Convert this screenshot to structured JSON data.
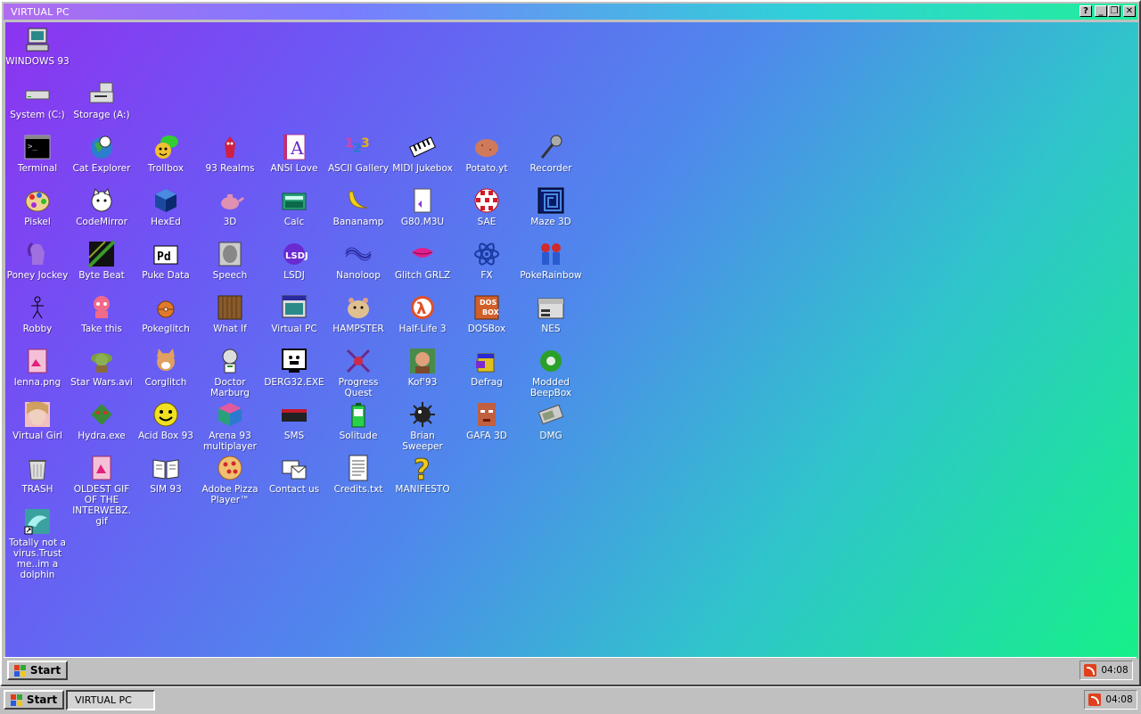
{
  "window": {
    "title": "VIRTUAL PC",
    "buttons": {
      "help": "?",
      "minimize": "_",
      "restore": "❐",
      "close": "✕"
    }
  },
  "desktop": {
    "icons": [
      {
        "label": "WINDOWS 93",
        "icon": "computer-icon"
      },
      {
        "label": "System (C:)",
        "icon": "hard-drive-icon"
      },
      {
        "label": "Storage (A:)",
        "icon": "floppy-drive-icon"
      },
      {
        "label": "Terminal",
        "icon": "terminal-icon"
      },
      {
        "label": "Cat Explorer",
        "icon": "cat-globe-icon"
      },
      {
        "label": "Trollbox",
        "icon": "chat-face-icon"
      },
      {
        "label": "93 Realms",
        "icon": "red-creature-icon"
      },
      {
        "label": "ANSI Love",
        "icon": "letter-a-book-icon"
      },
      {
        "label": "ASCII Gallery",
        "icon": "numbers-123-icon"
      },
      {
        "label": "MIDI Jukebox",
        "icon": "piano-keys-icon"
      },
      {
        "label": "Potato.yt",
        "icon": "potato-icon"
      },
      {
        "label": "Recorder",
        "icon": "microphone-icon"
      },
      {
        "label": "Piskel",
        "icon": "palette-icon"
      },
      {
        "label": "CodeMirror",
        "icon": "cat-face-icon"
      },
      {
        "label": "HexEd",
        "icon": "blue-cube-icon"
      },
      {
        "label": "3D",
        "icon": "teapot-icon"
      },
      {
        "label": "Calc",
        "icon": "calculator-icon"
      },
      {
        "label": "Bananamp",
        "icon": "banana-icon"
      },
      {
        "label": "G80.M3U",
        "icon": "audio-file-icon"
      },
      {
        "label": "SAE",
        "icon": "boing-ball-icon"
      },
      {
        "label": "Maze 3D",
        "icon": "maze-icon"
      },
      {
        "label": "Poney Jockey",
        "icon": "pony-icon"
      },
      {
        "label": "Byte Beat",
        "icon": "bytebeat-icon"
      },
      {
        "label": "Puke Data",
        "icon": "pd-icon"
      },
      {
        "label": "Speech",
        "icon": "speech-face-icon"
      },
      {
        "label": "LSDJ",
        "icon": "lsdj-icon"
      },
      {
        "label": "Nanoloop",
        "icon": "wave-icon"
      },
      {
        "label": "Glitch GRLZ",
        "icon": "lips-icon"
      },
      {
        "label": "FX",
        "icon": "atom-icon"
      },
      {
        "label": "PokeRainbow",
        "icon": "pokemon-trainers-icon"
      },
      {
        "label": "Robby",
        "icon": "stick-figure-icon"
      },
      {
        "label": "Take this",
        "icon": "pink-character-icon"
      },
      {
        "label": "Pokeglitch",
        "icon": "pokeball-icon"
      },
      {
        "label": "What If",
        "icon": "wooden-door-icon"
      },
      {
        "label": "Virtual PC",
        "icon": "window-app-icon"
      },
      {
        "label": "HAMPSTER",
        "icon": "hamster-icon"
      },
      {
        "label": "Half-Life 3",
        "icon": "lambda-icon"
      },
      {
        "label": "DOSBox",
        "icon": "dosbox-icon"
      },
      {
        "label": "NES",
        "icon": "nes-console-icon"
      },
      {
        "label": "lenna.png",
        "icon": "image-file-icon"
      },
      {
        "label": "Star Wars.avi",
        "icon": "yoda-icon"
      },
      {
        "label": "Corglitch",
        "icon": "corgi-icon"
      },
      {
        "label": "Doctor Marburg",
        "icon": "doctor-icon"
      },
      {
        "label": "DERG32.EXE",
        "icon": "monitor-face-icon"
      },
      {
        "label": "Progress Quest",
        "icon": "crossed-swords-icon"
      },
      {
        "label": "Kof'93",
        "icon": "fighter-icon"
      },
      {
        "label": "Defrag",
        "icon": "defrag-icon"
      },
      {
        "label": "Modded BeepBox",
        "icon": "green-ring-icon"
      },
      {
        "label": "Virtual Girl",
        "icon": "girl-face-icon"
      },
      {
        "label": "Hydra.exe",
        "icon": "hydra-icon"
      },
      {
        "label": "Acid Box 93",
        "icon": "smiley-icon"
      },
      {
        "label": "Arena 93 multiplayer",
        "icon": "cube-icon"
      },
      {
        "label": "SMS",
        "icon": "sms-console-icon"
      },
      {
        "label": "Solitude",
        "icon": "battery-icon"
      },
      {
        "label": "Brian Sweeper",
        "icon": "mine-icon"
      },
      {
        "label": "GAFA 3D",
        "icon": "doom-face-icon"
      },
      {
        "label": "DMG",
        "icon": "gameboy-icon"
      },
      {
        "label": "TRASH",
        "icon": "trash-icon"
      },
      {
        "label": "OLDEST GIF OF THE INTERWEBZ.gif",
        "icon": "gif-file-icon"
      },
      {
        "label": "SIM 93",
        "icon": "open-book-icon"
      },
      {
        "label": "Adobe Pizza Player™",
        "icon": "pizza-icon"
      },
      {
        "label": "Contact us",
        "icon": "contact-icon"
      },
      {
        "label": "Credits.txt",
        "icon": "text-file-icon"
      },
      {
        "label": "MANIFESTO",
        "icon": "question-mark-icon"
      },
      {
        "label": "Totally not a virus.Trust me..im a dolphin",
        "icon": "dolphin-shortcut-icon"
      }
    ]
  },
  "inner_taskbar": {
    "start_label": "Start",
    "clock": "04:08"
  },
  "outer_taskbar": {
    "start_label": "Start",
    "task_label": "VIRTUAL PC",
    "clock": "04:08"
  }
}
